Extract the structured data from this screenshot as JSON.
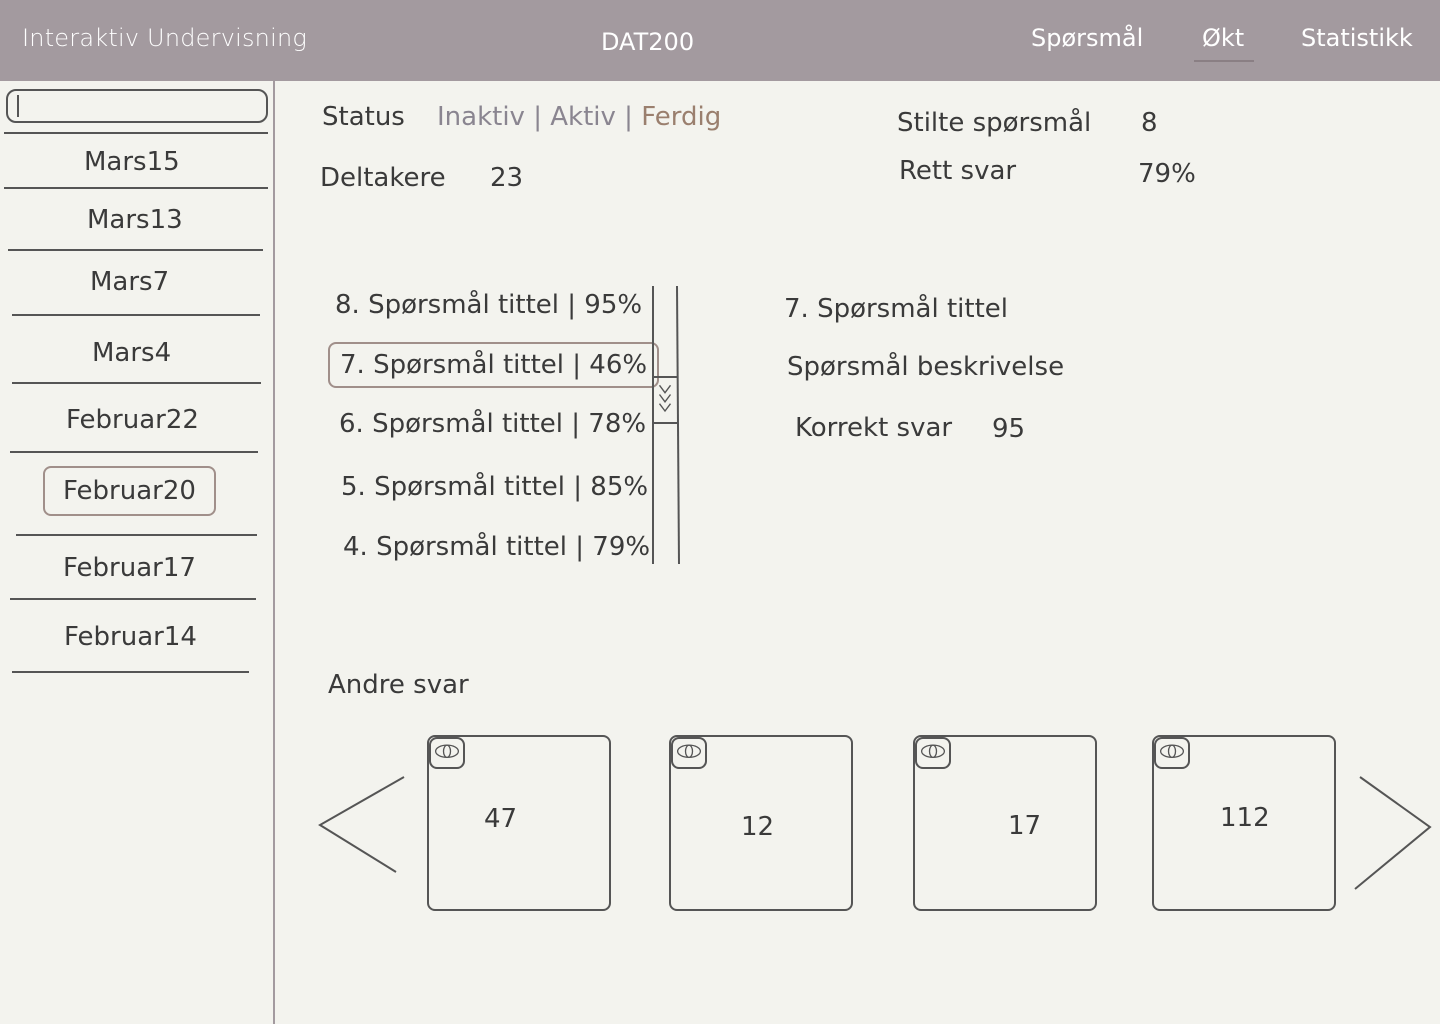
{
  "header": {
    "app_title": "Interaktiv Undervisning",
    "course": "DAT200",
    "nav": [
      "Spørsmål",
      "Økt",
      "Statistikk"
    ]
  },
  "sidebar": {
    "search_value": "",
    "sessions": [
      "Mars15",
      "Mars13",
      "Mars7",
      "Mars4",
      "Februar22",
      "Februar20",
      "Februar17",
      "Februar14"
    ],
    "selected": "Februar20"
  },
  "session": {
    "status_label": "Status",
    "status_options": [
      "Inaktiv",
      "Aktiv",
      "Ferdig"
    ],
    "status_separator": "|",
    "participants_label": "Deltakere",
    "participants_value": "23",
    "asked_label": "Stilte spørsmål",
    "asked_value": "8",
    "correct_label": "Rett svar",
    "correct_value": "79%"
  },
  "questions": [
    {
      "label": "8. Spørsmål tittel  | 95%"
    },
    {
      "label": "7. Spørsmål tittel | 46%"
    },
    {
      "label": "6. Spørsmål tittel | 78%"
    },
    {
      "label": "5. Spørsmål tittel | 85%"
    },
    {
      "label": "4. Spørsmål tittel | 79%"
    }
  ],
  "detail": {
    "title": "7. Spørsmål tittel",
    "description": "Spørsmål beskrivelse",
    "correct_label": "Korrekt svar",
    "correct_value": "95"
  },
  "other_answers": {
    "label": "Andre svar",
    "values": [
      "47",
      "12",
      "17",
      "112"
    ]
  },
  "colors": {
    "topbar": "#a39a9f",
    "background": "#f3f3ee",
    "accent": "#9a7f6e"
  }
}
